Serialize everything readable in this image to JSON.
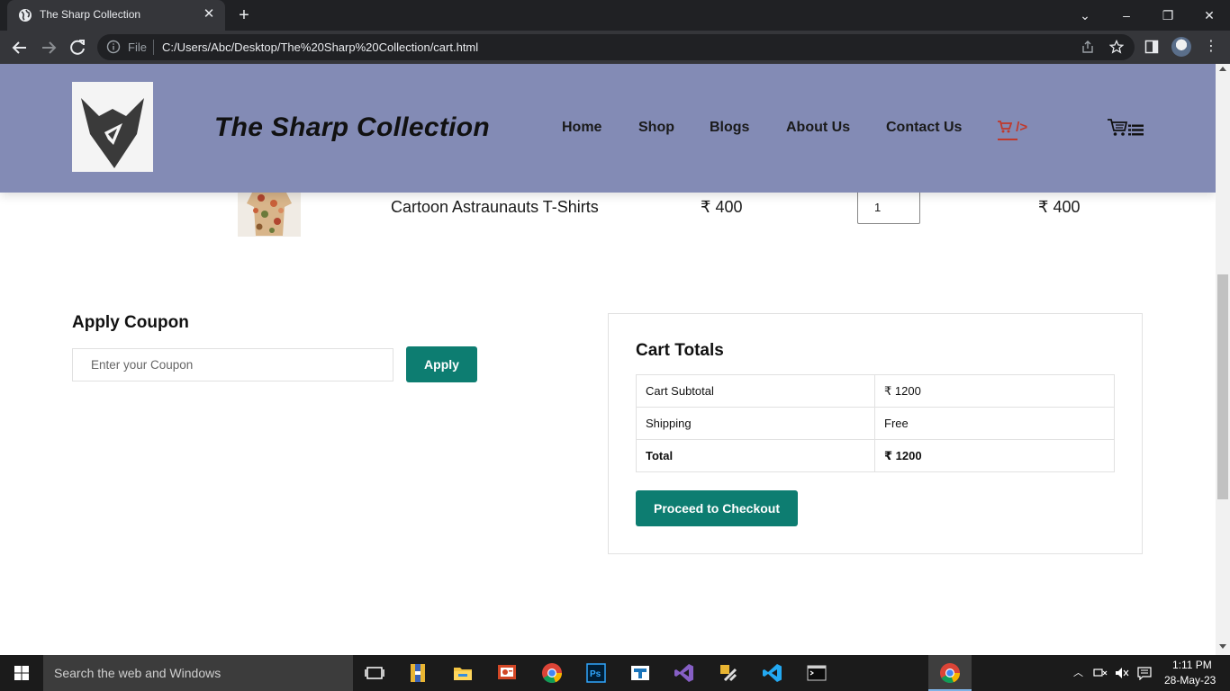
{
  "browser": {
    "tab_title": "The Sharp Collection",
    "tab_close": "✕",
    "new_tab": "+",
    "file_label": "File",
    "url": "C:/Users/Abc/Desktop/The%20Sharp%20Collection/cart.html",
    "window_controls": {
      "chevron": "⌄",
      "minimize": "–",
      "restore": "❐",
      "close": "✕"
    },
    "menu": "⋮"
  },
  "site": {
    "title": "The Sharp Collection",
    "nav": [
      "Home",
      "Shop",
      "Blogs",
      "About Us",
      "Contact Us"
    ],
    "nav_cart_text": "/>",
    "accent_color": "#0d7d71",
    "header_color": "#838bb5"
  },
  "cart": {
    "items": [
      {
        "remove": "",
        "name": "Cartoon Astraunauts T-Shirts",
        "price": "₹ 400",
        "quantity": "1",
        "subtotal": "₹ 400"
      }
    ]
  },
  "coupon": {
    "title": "Apply Coupon",
    "placeholder": "Enter your Coupon",
    "button": "Apply"
  },
  "totals": {
    "title": "Cart Totals",
    "rows": [
      {
        "label": "Cart Subtotal",
        "value": "₹ 1200"
      },
      {
        "label": "Shipping",
        "value": "Free"
      },
      {
        "label": "Total",
        "value": "₹ 1200"
      }
    ],
    "checkout_button": "Proceed to Checkout"
  },
  "taskbar": {
    "search_placeholder": "Search the web and Windows",
    "time": "1:11 PM",
    "date": "28-May-23",
    "tray_caret": "︿"
  }
}
